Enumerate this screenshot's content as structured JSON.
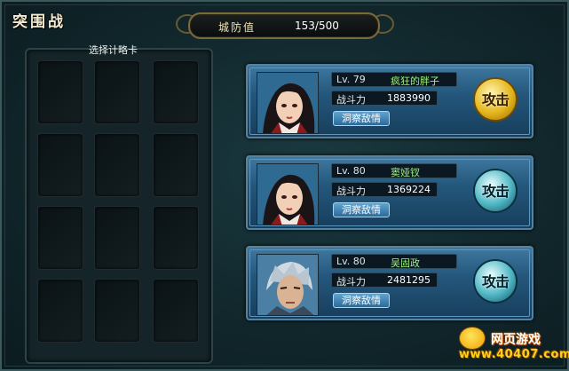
{
  "window": {
    "title": "突围战"
  },
  "defense": {
    "label": "城防值",
    "value": "153/500"
  },
  "cards": {
    "title": "选择计略卡",
    "slots": 12
  },
  "enemies": [
    {
      "level": "Lv. 79",
      "name": "疯狂的胖子",
      "power_label": "战斗力",
      "power": "1883990",
      "scout_label": "洞察敌情",
      "attack_label": "攻击",
      "attack_style": "gold",
      "portrait": "female-warrior-portrait"
    },
    {
      "level": "Lv. 80",
      "name": "窦娅钗",
      "power_label": "战斗力",
      "power": "1369224",
      "scout_label": "洞察敌情",
      "attack_label": "攻击",
      "attack_style": "teal",
      "portrait": "female-warrior-portrait"
    },
    {
      "level": "Lv. 80",
      "name": "吴固政",
      "power_label": "战斗力",
      "power": "2481295",
      "scout_label": "洞察敌情",
      "attack_label": "攻击",
      "attack_style": "teal",
      "portrait": "male-warrior-portrait"
    }
  ],
  "watermark": {
    "line1": "网页游戏",
    "line2": "www.40407.com"
  }
}
